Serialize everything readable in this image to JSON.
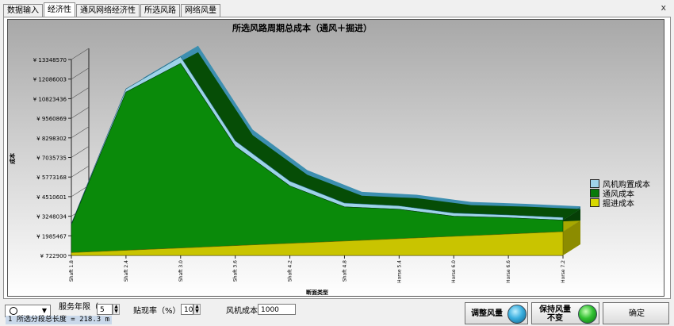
{
  "tabs": [
    {
      "label": "数据输入"
    },
    {
      "label": "经济性"
    },
    {
      "label": "通风网络经济性"
    },
    {
      "label": "所选风路"
    },
    {
      "label": "网络风量"
    }
  ],
  "active_tab": 1,
  "close_symbol": "x",
  "colors": {
    "fan_purchase": "#9ed3e8",
    "ventilation": "#0a7a0a",
    "excavation": "#d8d800",
    "panel_border": "#555555"
  },
  "chart_data": {
    "type": "area",
    "title": "所选风路周期总成本（通风＋掘进）",
    "xlabel": "断面类型",
    "ylabel": "成本",
    "y_currency": "¥",
    "y_ticks": [
      722900,
      1985467,
      3248034,
      4510601,
      5773168,
      7035735,
      8298302,
      9560869,
      10823436,
      12086003,
      13348570
    ],
    "ylim": [
      722900,
      13348570
    ],
    "categories": [
      "Shaft 1.8",
      "Shaft 2.4",
      "Shaft 3.0",
      "Shaft 3.6",
      "Shaft 4.2",
      "Shaft 4.8",
      "Horse 5.4",
      "Horse 6.0",
      "Horse 6.6",
      "Horse 7.2"
    ],
    "stacked": true,
    "three_d": true,
    "legend_position": "right",
    "series": [
      {
        "name": "风机购置成本",
        "values": [
          60000,
          200000,
          420000,
          360000,
          300000,
          250000,
          220000,
          200000,
          180000,
          170000
        ]
      },
      {
        "name": "通风成本",
        "values": [
          1800000,
          10200000,
          11900000,
          6400000,
          3700000,
          2200000,
          1900000,
          1300000,
          1050000,
          750000
        ]
      },
      {
        "name": "掘进成本",
        "values": [
          900000,
          1050000,
          1200000,
          1350000,
          1500000,
          1650000,
          1800000,
          1950000,
          2100000,
          2250000
        ]
      }
    ]
  },
  "controls": {
    "combo_value": "",
    "service_years_label": "服务年限（",
    "service_years_value": "5",
    "discount_label": "贴现率（%）",
    "discount_value": "10",
    "fan_cost_label": "风机成本",
    "fan_cost_value": "1000",
    "status_text": "1 所选分段总长度 = 218.3 m",
    "adjust_button": "调整风量",
    "keep_button_line1": "保持风量",
    "keep_button_line2": "不变",
    "ok_button": "确定"
  }
}
